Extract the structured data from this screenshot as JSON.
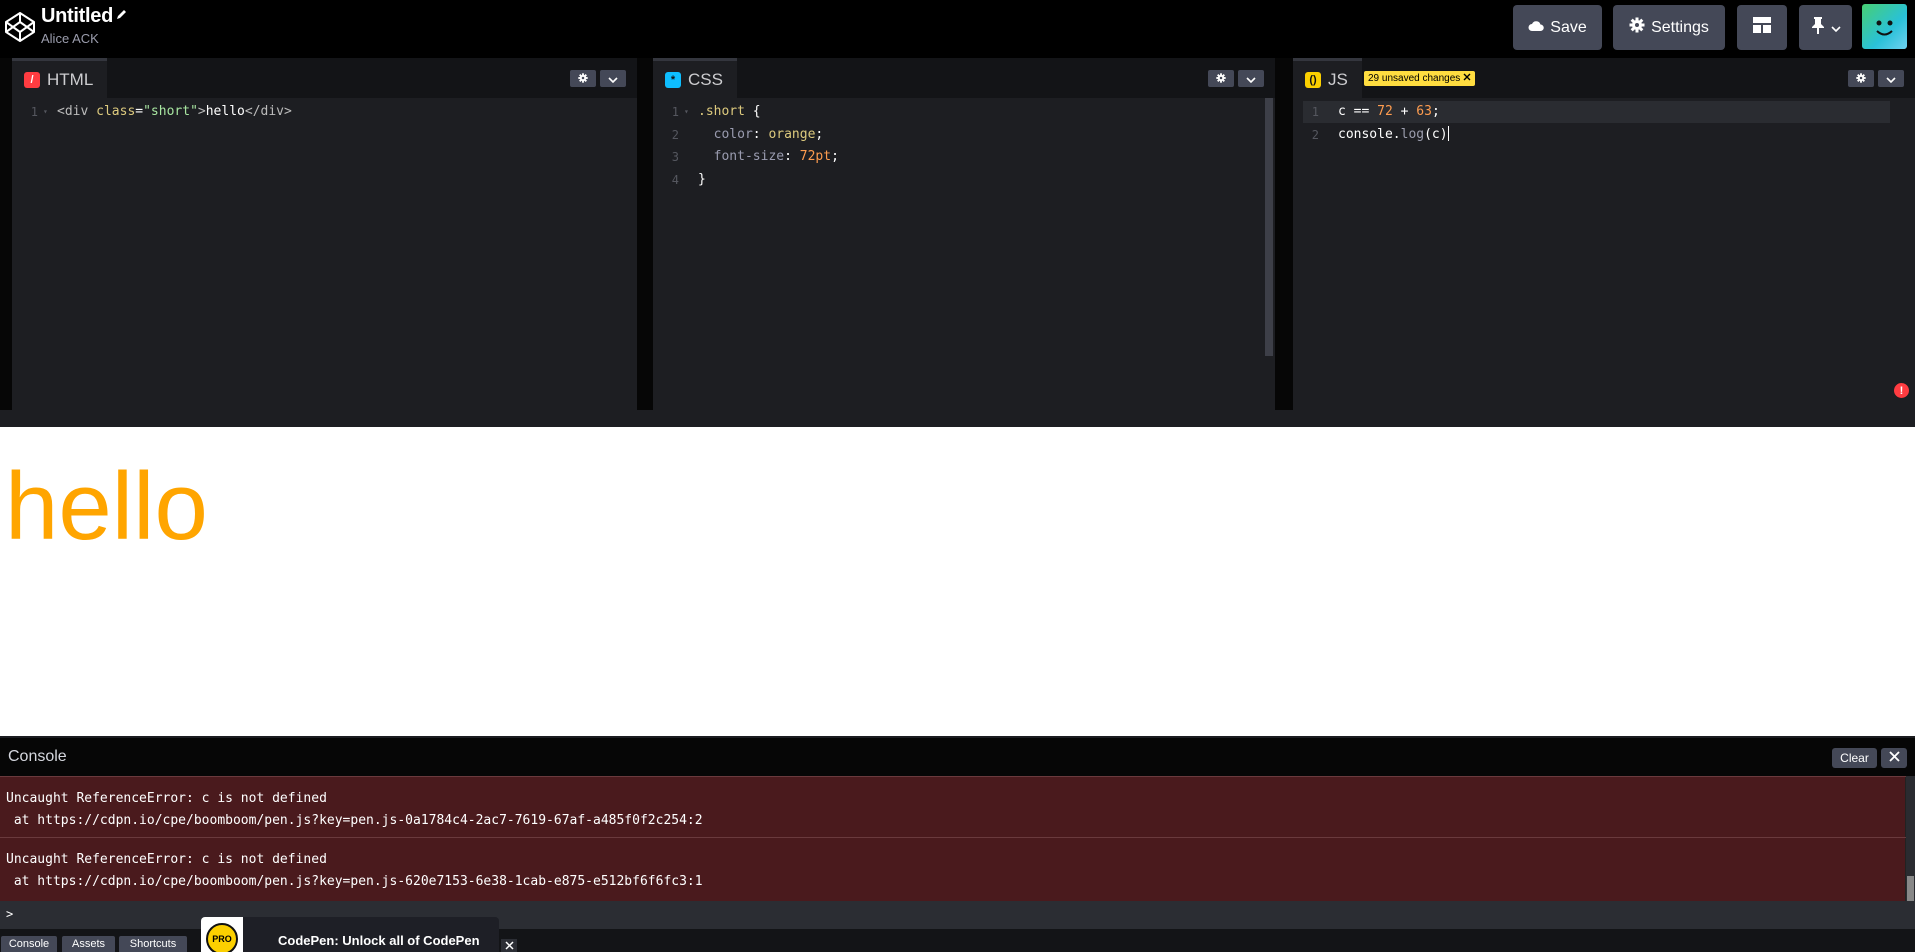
{
  "header": {
    "pen_title": "Untitled",
    "author": "Alice ACK",
    "save_label": "Save",
    "settings_label": "Settings"
  },
  "editors": {
    "html": {
      "label": "HTML",
      "lines": [
        {
          "n": "1",
          "parts": [
            [
              "t-tag",
              "<div "
            ],
            [
              "t-attr",
              "class"
            ],
            [
              "t-punc",
              "="
            ],
            [
              "t-str",
              "\"short\""
            ],
            [
              "t-tag",
              ">"
            ],
            [
              "t-punc",
              "hello"
            ],
            [
              "t-tag",
              "</div>"
            ]
          ]
        }
      ]
    },
    "css": {
      "label": "CSS",
      "lines": [
        {
          "n": "1",
          "parts": [
            [
              "t-sel",
              ".short"
            ],
            [
              "t-punc",
              " {"
            ]
          ]
        },
        {
          "n": "2",
          "parts": [
            [
              "t-prop",
              "  color"
            ],
            [
              "t-punc",
              ": "
            ],
            [
              "t-val",
              "orange"
            ],
            [
              "t-punc",
              ";"
            ]
          ]
        },
        {
          "n": "3",
          "parts": [
            [
              "t-prop",
              "  font-size"
            ],
            [
              "t-punc",
              ": "
            ],
            [
              "t-num",
              "72pt"
            ],
            [
              "t-punc",
              ";"
            ]
          ]
        },
        {
          "n": "4",
          "parts": [
            [
              "t-punc",
              "}"
            ]
          ]
        }
      ]
    },
    "js": {
      "label": "JS",
      "unsaved_badge": "29 unsaved changes",
      "lines": [
        {
          "n": "1",
          "parts": [
            [
              "t-punc",
              "c == "
            ],
            [
              "t-num",
              "72"
            ],
            [
              "t-punc",
              " + "
            ],
            [
              "t-num",
              "63"
            ],
            [
              "t-punc",
              ";"
            ]
          ]
        },
        {
          "n": "2",
          "parts": [
            [
              "t-punc",
              "console"
            ],
            [
              "t-punc",
              "."
            ],
            [
              "t-fn",
              "log"
            ],
            [
              "t-punc",
              "(c)"
            ]
          ]
        }
      ]
    }
  },
  "preview": {
    "text": "hello",
    "text_color": "#ffa500"
  },
  "console": {
    "title": "Console",
    "clear_label": "Clear",
    "entries": [
      {
        "message": "Uncaught ReferenceError: c is not defined",
        "location": " at https://cdpn.io/cpe/boomboom/pen.js?key=pen.js-0a1784c4-2ac7-7619-67af-a485f0f2c254:2"
      },
      {
        "message": "Uncaught ReferenceError: c is not defined",
        "location": " at https://cdpn.io/cpe/boomboom/pen.js?key=pen.js-620e7153-6e38-1cab-e875-e512bf6f6fc3:1"
      }
    ],
    "prompt": ">"
  },
  "footer": {
    "console_tab": "Console",
    "assets_tab": "Assets",
    "shortcuts_tab": "Shortcuts",
    "promo_badge": "PRO",
    "promo_text": "CodePen: Unlock all of CodePen"
  },
  "colors": {
    "accent_html": "#ff3c41",
    "accent_css": "#0ebeff",
    "accent_js": "#fcd000",
    "error_bg": "#4a1a1d"
  }
}
